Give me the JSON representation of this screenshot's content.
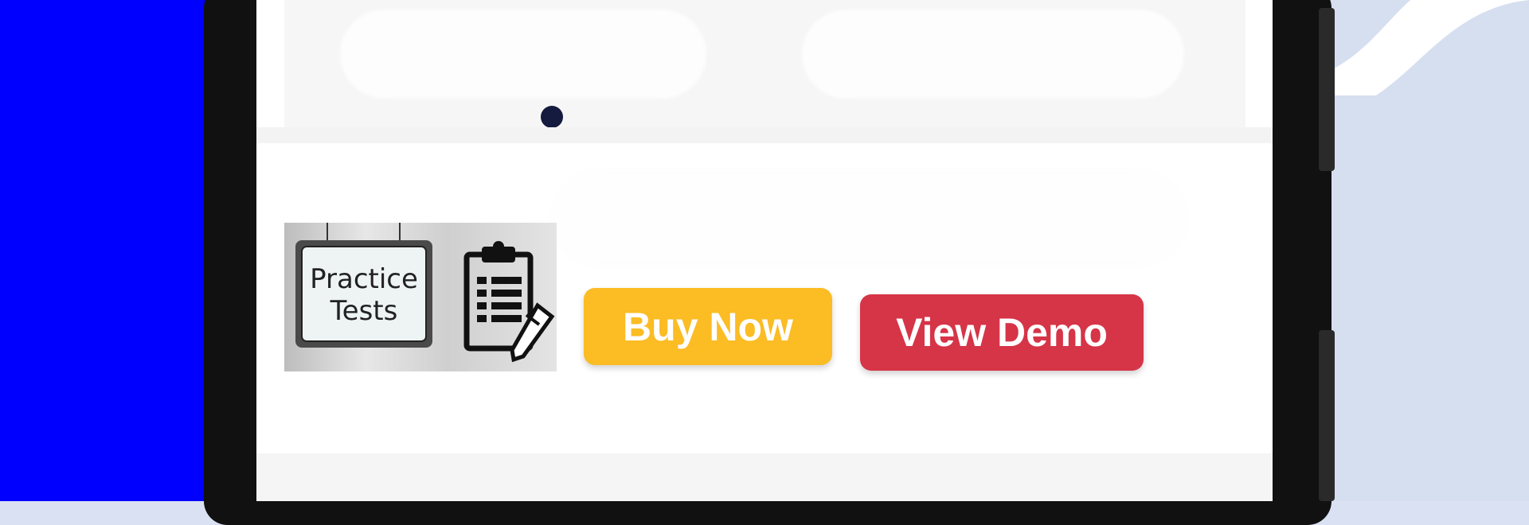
{
  "colors": {
    "left_panel": "#0000ff",
    "right_background": "#d6dff0",
    "buy_button": "#fbbc24",
    "demo_button": "#d63447",
    "carousel_dot": "#141b3e"
  },
  "banner": {
    "carousel_active_index": 1
  },
  "product": {
    "image_icon": "clipboard-pencil-icon",
    "image_sign_line1": "Practice",
    "image_sign_line2": "Tests",
    "buy_label": "Buy Now",
    "demo_label": "View Demo"
  }
}
